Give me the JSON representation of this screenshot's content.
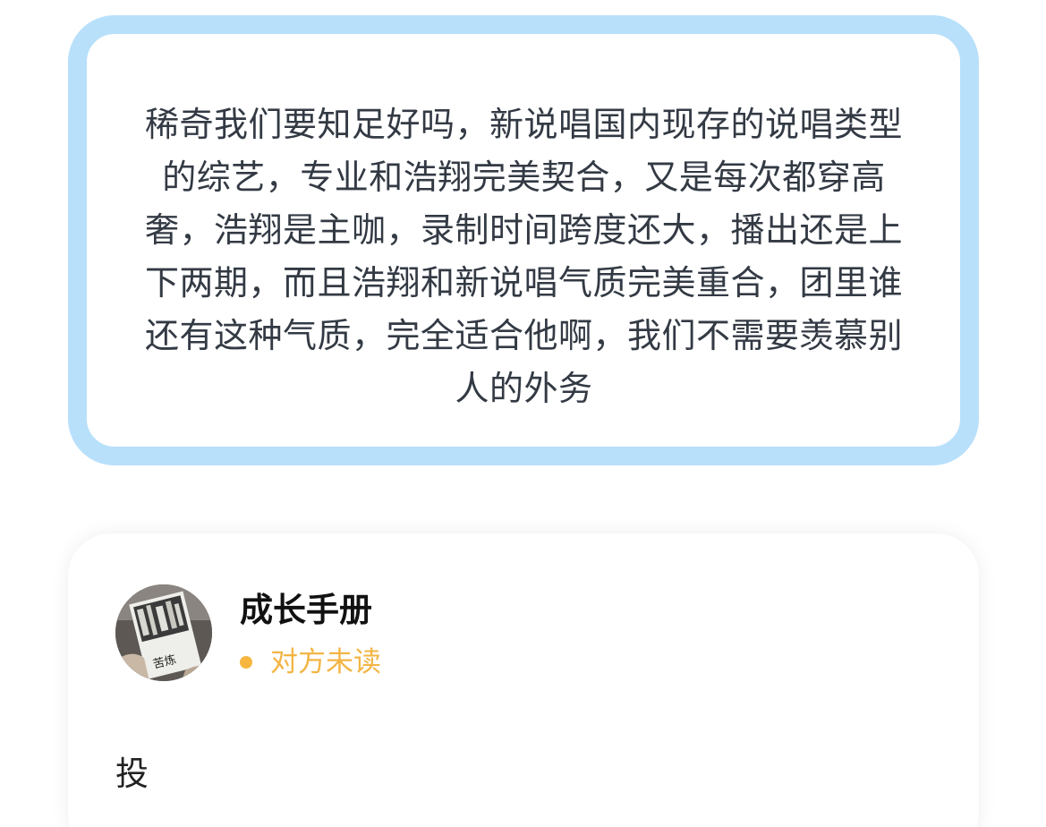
{
  "quote": {
    "text": "稀奇我们要知足好吗，新说唱国内现存的说唱类型的综艺，专业和浩翔完美契合，又是每次都穿高奢，浩翔是主咖，录制时间跨度还大，播出还是上下两期，而且浩翔和新说唱气质完美重合，团里谁还有这种气质，完全适合他啊，我们不需要羡慕别人的外务"
  },
  "reply": {
    "avatar_icon": "book-photo-avatar",
    "avatar_caption": "苦炼",
    "user_name": "成长手册",
    "status_text": "对方未读",
    "status_color": "#f6b640",
    "message": "投"
  },
  "colors": {
    "quote_border": "#b8e0fb",
    "text": "#333a44"
  }
}
